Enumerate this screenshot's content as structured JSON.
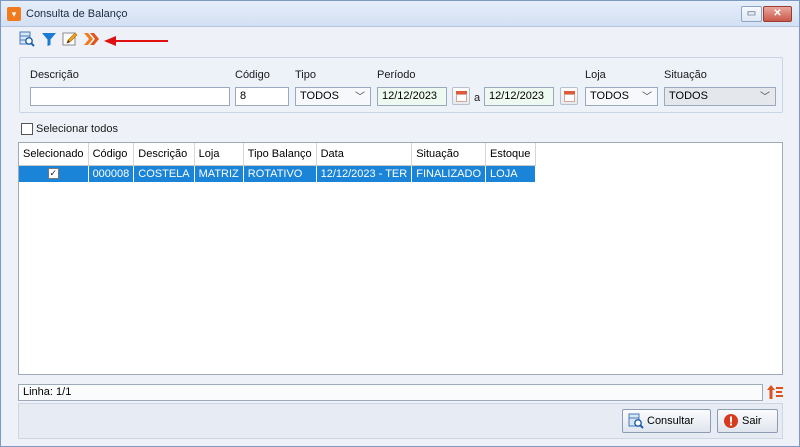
{
  "window": {
    "title": "Consulta de Balanço",
    "min_glyph": "▭",
    "close_glyph": "✕"
  },
  "toolbar": {
    "icons": [
      "search-grid-icon",
      "filter-icon",
      "edit-icon",
      "forward-icon"
    ]
  },
  "filters": {
    "descricao_label": "Descrição",
    "descricao_value": "",
    "codigo_label": "Código",
    "codigo_value": "8",
    "tipo_label": "Tipo",
    "tipo_value": "TODOS",
    "periodo_label": "Período",
    "periodo_start": "12/12/2023",
    "periodo_sep": "a",
    "periodo_end": "12/12/2023",
    "loja_label": "Loja",
    "loja_value": "TODOS",
    "situacao_label": "Situação",
    "situacao_value": "TODOS"
  },
  "select_all_label": "Selecionar todos",
  "grid": {
    "columns": [
      "Selecionado",
      "Código",
      "Descrição",
      "Loja",
      "Tipo Balanço",
      "Data",
      "Situação",
      "Estoque"
    ],
    "rows": [
      [
        "✓",
        "000008",
        "COSTELA",
        "MATRIZ",
        "ROTATIVO",
        "12/12/2023 - TER",
        "FINALIZADO",
        "LOJA"
      ]
    ]
  },
  "status": {
    "line_text": "Linha: 1/1"
  },
  "buttons": {
    "consultar": "Consultar",
    "sair": "Sair"
  },
  "colors": {
    "selection": "#1a84d8",
    "accent_orange": "#f07a1e",
    "annotation_red": "#e01010"
  }
}
